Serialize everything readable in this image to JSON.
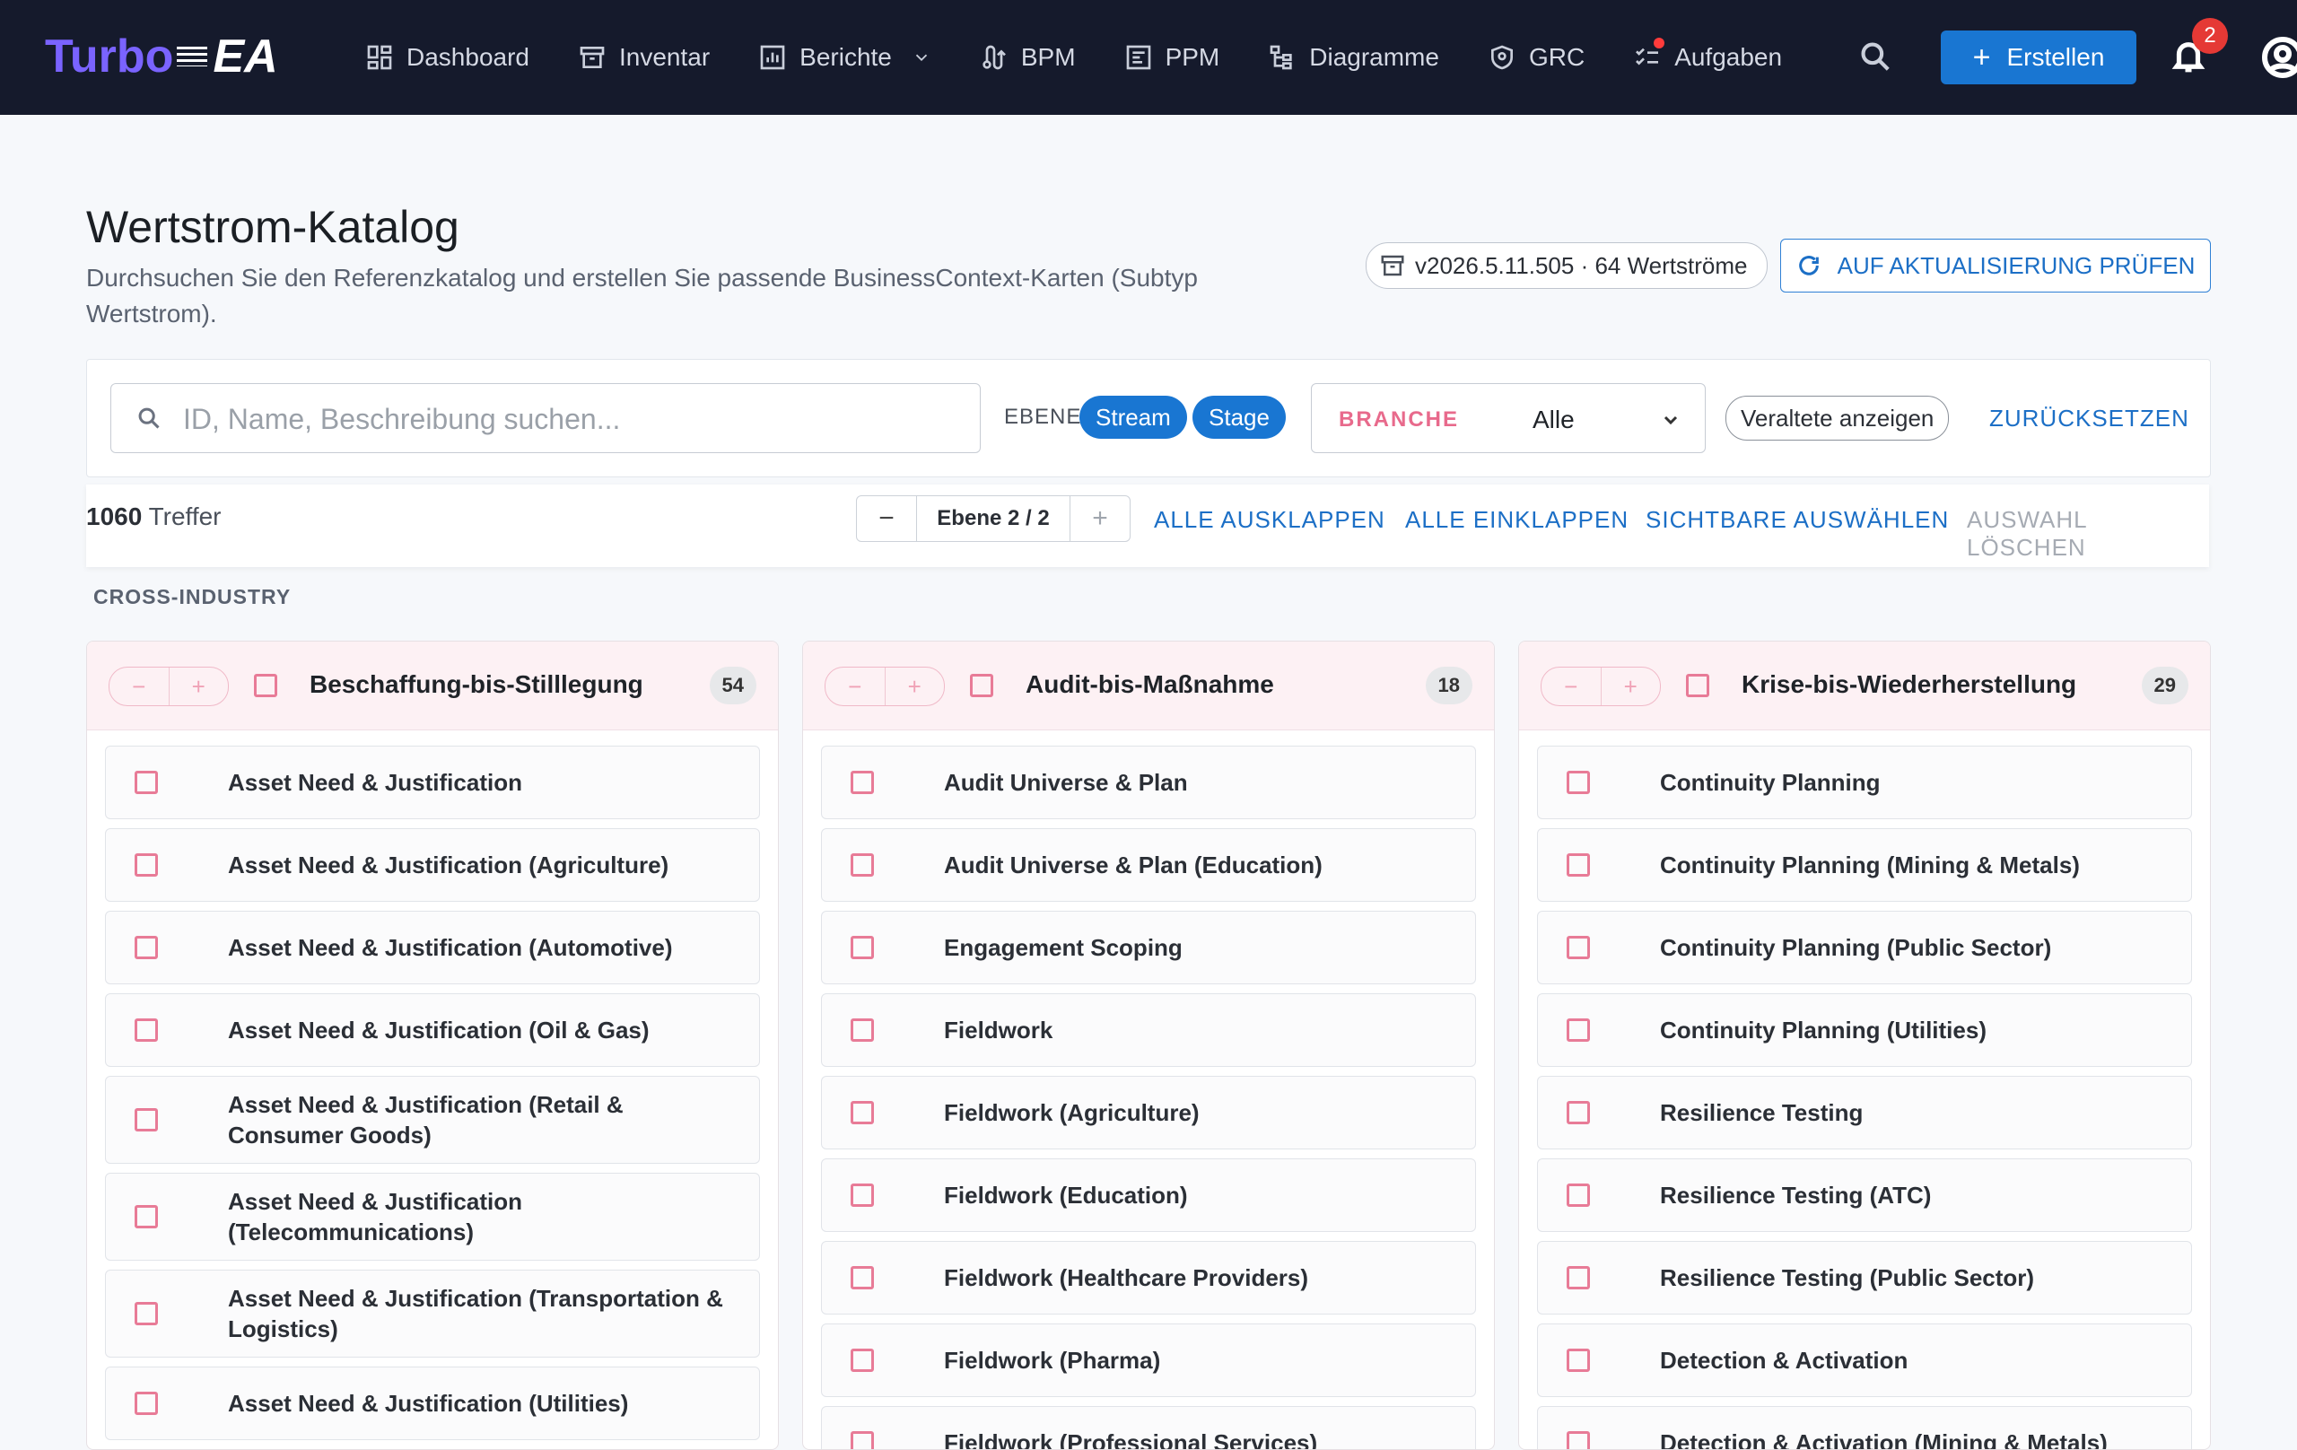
{
  "app": {
    "logo_main": "Turbo",
    "logo_accent": "EA",
    "nav": [
      {
        "label": "Dashboard",
        "icon": "dashboard-icon"
      },
      {
        "label": "Inventar",
        "icon": "archive-icon"
      },
      {
        "label": "Berichte",
        "icon": "report-chart-icon"
      },
      {
        "label": "BPM",
        "icon": "process-icon"
      },
      {
        "label": "PPM",
        "icon": "project-icon"
      },
      {
        "label": "Diagramme",
        "icon": "diagram-icon"
      },
      {
        "label": "GRC",
        "icon": "shield-icon"
      },
      {
        "label": "Aufgaben",
        "icon": "tasks-icon"
      }
    ],
    "create_label": "Erstellen",
    "notification_count": "2"
  },
  "header": {
    "title": "Wertstrom-Katalog",
    "subtitle": "Durchsuchen Sie den Referenzkatalog und erstellen Sie passende BusinessContext-Karten (Subtyp Wertstrom).",
    "version": "v2026.5.11.505 · 64 Wertströme",
    "update_button": "AUF AKTUALISIERUNG PRÜFEN"
  },
  "filters": {
    "search_placeholder": "ID, Name, Beschreibung suchen...",
    "level_label": "EBENE",
    "level_chips": [
      "Stream",
      "Stage"
    ],
    "branch_label": "BRANCHE",
    "branch_value": "Alle",
    "deprecated_label": "Veraltete anzeigen",
    "reset_label": "ZURÜCKSETZEN"
  },
  "results": {
    "count": "1060",
    "count_suffix": "Treffer",
    "level_text": "Ebene 2 / 2",
    "minus": "−",
    "plus": "+",
    "expand_all": "ALLE AUSKLAPPEN",
    "collapse_all": "ALLE EINKLAPPEN",
    "select_visible": "SICHTBARE AUSWÄHLEN",
    "clear_selection": "AUSWAHL LÖSCHEN"
  },
  "section": "CROSS-INDUSTRY",
  "columns": [
    {
      "title": "Beschaffung-bis-Stilllegung",
      "count": "54",
      "items": [
        "Asset Need & Justification",
        "Asset Need & Justification (Agriculture)",
        "Asset Need & Justification (Automotive)",
        "Asset Need & Justification (Oil & Gas)",
        "Asset Need & Justification (Retail & Consumer Goods)",
        "Asset Need & Justification (Telecommunications)",
        "Asset Need & Justification (Transportation & Logistics)",
        "Asset Need & Justification (Utilities)"
      ]
    },
    {
      "title": "Audit-bis-Maßnahme",
      "count": "18",
      "items": [
        "Audit Universe & Plan",
        "Audit Universe & Plan (Education)",
        "Engagement Scoping",
        "Fieldwork",
        "Fieldwork (Agriculture)",
        "Fieldwork (Education)",
        "Fieldwork (Healthcare Providers)",
        "Fieldwork (Pharma)",
        "Fieldwork (Professional Services)"
      ]
    },
    {
      "title": "Krise-bis-Wiederherstellung",
      "count": "29",
      "items": [
        "Continuity Planning",
        "Continuity Planning (Mining & Metals)",
        "Continuity Planning (Public Sector)",
        "Continuity Planning (Utilities)",
        "Resilience Testing",
        "Resilience Testing (ATC)",
        "Resilience Testing (Public Sector)",
        "Detection & Activation",
        "Detection & Activation (Mining & Metals)"
      ]
    }
  ]
}
